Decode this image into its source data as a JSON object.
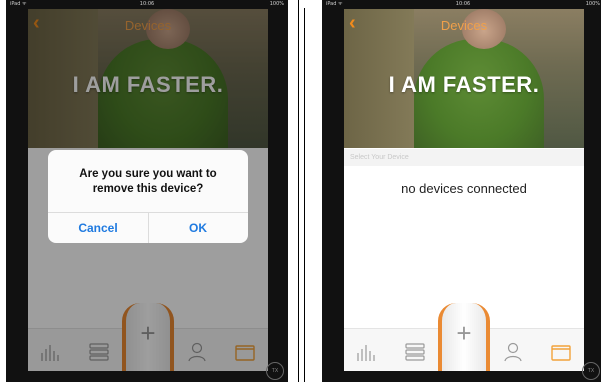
{
  "screens": [
    {
      "status": {
        "carrier": "iPad ᯤ",
        "time": "10:06",
        "battery": "100%"
      },
      "nav": {
        "back": "‹",
        "title": "Devices"
      },
      "hero": {
        "tagline": "I AM FASTER."
      },
      "alert": {
        "message": "Are you sure you want to remove this device?",
        "cancel": "Cancel",
        "ok": "OK"
      },
      "tabs": [
        "stats-icon",
        "list-icon",
        "add-icon",
        "profile-icon",
        "folder-icon"
      ],
      "center_button": "+",
      "home_button": "TX"
    },
    {
      "status": {
        "carrier": "iPad ᯤ",
        "time": "10:06",
        "battery": "100%"
      },
      "nav": {
        "back": "‹",
        "title": "Devices"
      },
      "hero": {
        "tagline": "I AM FASTER."
      },
      "section_label": "Select Your Device",
      "empty_text": "no devices connected",
      "tabs": [
        "stats-icon",
        "list-icon",
        "add-icon",
        "profile-icon",
        "folder-icon"
      ],
      "center_button": "+",
      "home_button": "TX"
    }
  ],
  "colors": {
    "accent": "#f28b1c",
    "alert_button": "#1f7ae0",
    "hero_green": "#4b7a28"
  }
}
